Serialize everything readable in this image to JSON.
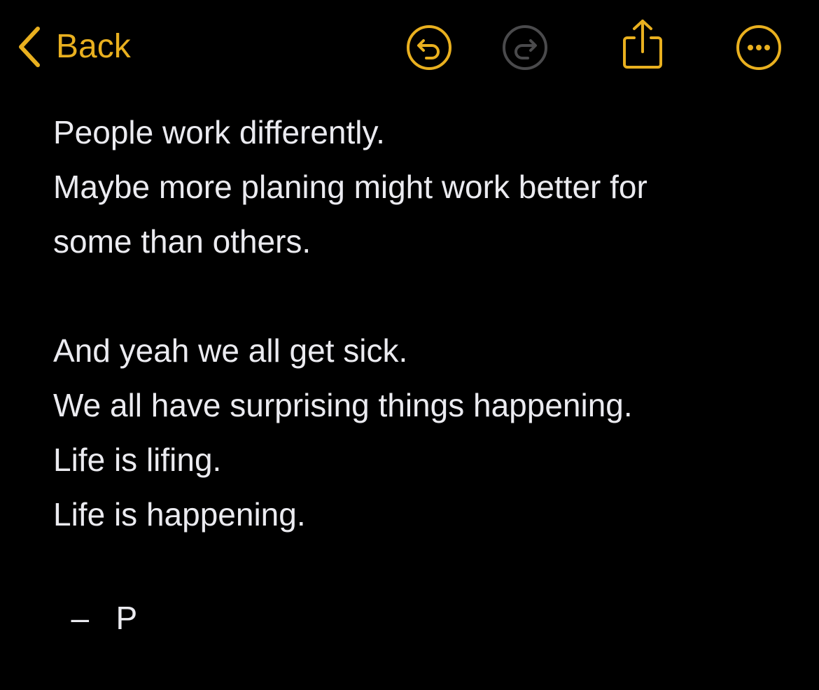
{
  "toolbar": {
    "back_label": "Back",
    "back_icon": "chevron-left-icon",
    "undo_icon": "undo-icon",
    "redo_icon": "redo-icon",
    "share_icon": "share-icon",
    "more_icon": "ellipsis-circle-icon",
    "accent_color": "#e9b01f",
    "disabled_color": "#4a4a4c"
  },
  "note": {
    "paragraph_1": [
      "People work differently.",
      "Maybe more planing might work better for",
      "some than others."
    ],
    "paragraph_2": [
      "And yeah we all get sick.",
      "We all have surprising things happening.",
      "Life is lifing.",
      "Life is happening."
    ],
    "signature": "  –   P"
  },
  "colors": {
    "background": "#000000",
    "text": "#ebebf0"
  }
}
